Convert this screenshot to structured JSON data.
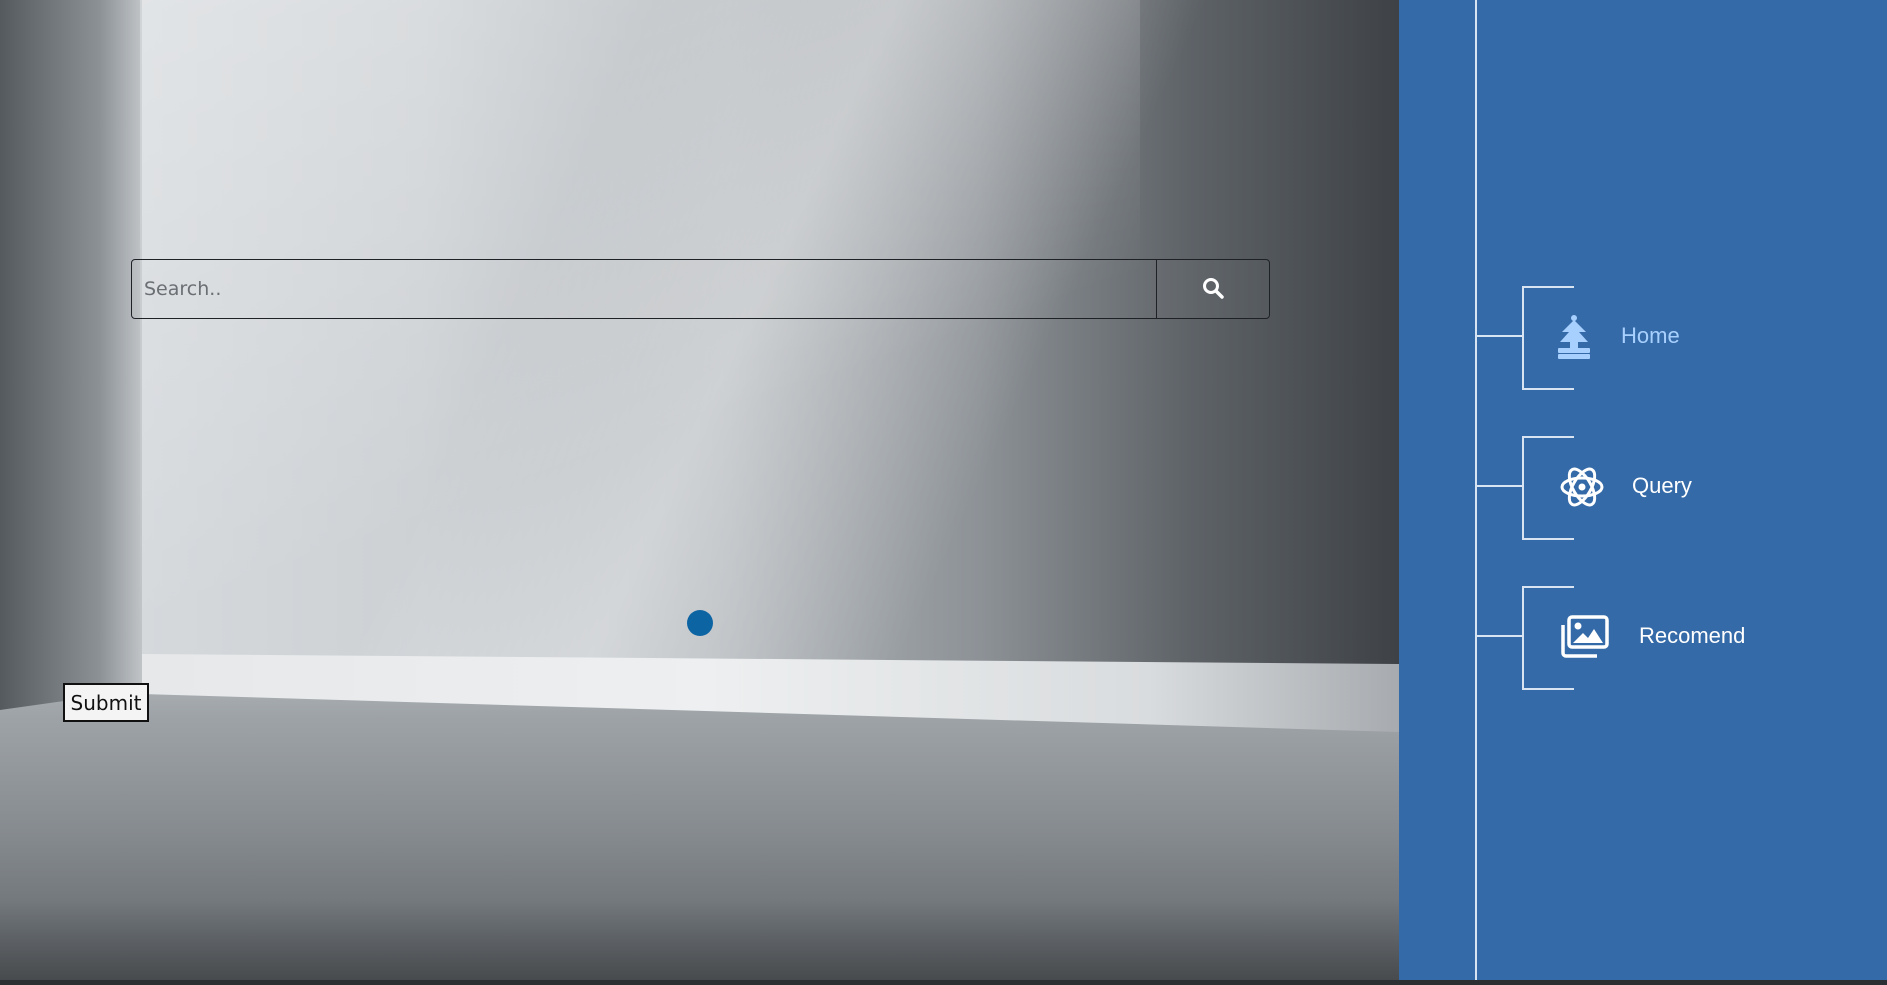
{
  "search": {
    "placeholder": "Search..",
    "value": "",
    "button_icon": "search-icon"
  },
  "form": {
    "submit_label": "Submit"
  },
  "sidebar": {
    "background": "#346aa7",
    "items": [
      {
        "label": "Home",
        "icon": "home-icon",
        "color": "#a8d0ff",
        "active": true
      },
      {
        "label": "Query",
        "icon": "atom-icon",
        "color": "#ffffff",
        "active": false
      },
      {
        "label": "Recomend",
        "icon": "images-icon",
        "color": "#ffffff",
        "active": false
      }
    ]
  },
  "colors": {
    "dot": "#0d64a3",
    "sidebar_line": "#d8e4f1"
  }
}
